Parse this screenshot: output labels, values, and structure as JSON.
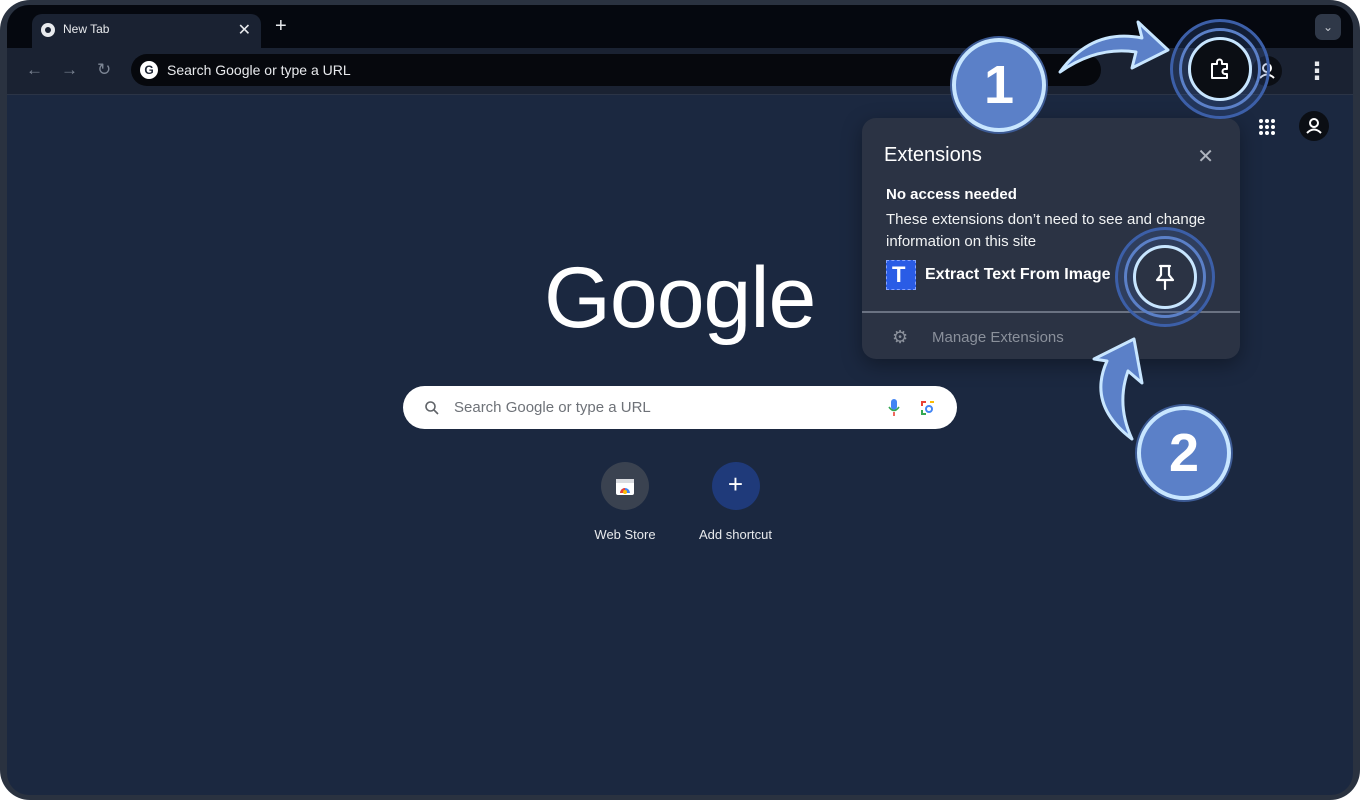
{
  "tab": {
    "title": "New Tab",
    "close": "✕"
  },
  "new_tab_symbol": "+",
  "tab_search_symbol": "⌄",
  "toolbar": {
    "back": "←",
    "forward": "→",
    "reload": "↻",
    "omnibox_badge": "G",
    "omnibox_text": "Search Google or type a URL",
    "menu": "⋮"
  },
  "ntp": {
    "logo": "Google",
    "search_placeholder": "Search Google or type a URL",
    "shortcuts": [
      {
        "label": "Web Store"
      },
      {
        "label": "Add shortcut",
        "symbol": "+"
      }
    ]
  },
  "extensions_popup": {
    "title": "Extensions",
    "close": "✕",
    "section_heading": "No access needed",
    "section_description": "These extensions don’t need to see and change information on this site",
    "item_icon_letter": "T",
    "item_name": "Extract Text From Image",
    "manage_icon": "⚙",
    "manage_label": "Manage Extensions"
  },
  "annotations": {
    "step1": "1",
    "step2": "2"
  },
  "colors": {
    "page_bg": "#1b2840",
    "toolbar_bg": "#1a2232",
    "tabstrip_bg": "#05080f",
    "popup_bg": "#2b3344",
    "annotation_fill": "#5b80c8",
    "annotation_ring": "#c8e6ff",
    "extension_icon": "#2a5ce6",
    "add_shortcut_circle": "#1f3a7a"
  },
  "icons": [
    "chrome-icon",
    "back-arrow-icon",
    "forward-arrow-icon",
    "reload-icon",
    "google-g-icon",
    "puzzle-icon",
    "profile-icon",
    "kebab-menu-icon",
    "apps-grid-icon",
    "search-icon",
    "mic-icon",
    "lens-icon",
    "webstore-icon",
    "plus-icon",
    "pin-icon",
    "gear-icon",
    "close-icon"
  ]
}
